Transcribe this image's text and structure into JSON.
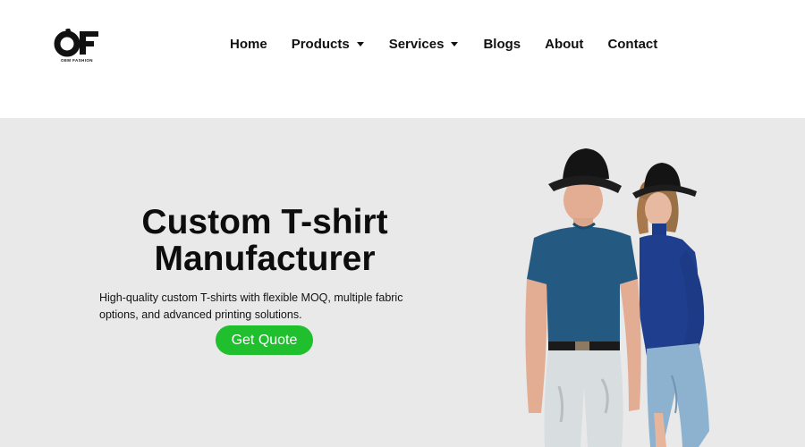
{
  "logo": {
    "mark": "OF",
    "text": "OEM FASHION",
    "icon": "of-logo-icon"
  },
  "nav": {
    "items": [
      {
        "label": "Home",
        "has_dropdown": false
      },
      {
        "label": "Products",
        "has_dropdown": true
      },
      {
        "label": "Services",
        "has_dropdown": true
      },
      {
        "label": "Blogs",
        "has_dropdown": false
      },
      {
        "label": "About",
        "has_dropdown": false
      },
      {
        "label": "Contact",
        "has_dropdown": false
      }
    ]
  },
  "hero": {
    "title_line1": "Custom T-shirt",
    "title_line2": "Manufacturer",
    "description": "High-quality custom T-shirts with flexible MOQ, multiple fabric options, and advanced printing solutions.",
    "cta_label": "Get Quote",
    "image_subject": "two models in blue t-shirts and black bucket hats"
  },
  "colors": {
    "hero_background": "#e9e9e9",
    "cta_background": "#1fbf2e",
    "text_dark": "#111111",
    "shirt_blue": "#245a82"
  }
}
